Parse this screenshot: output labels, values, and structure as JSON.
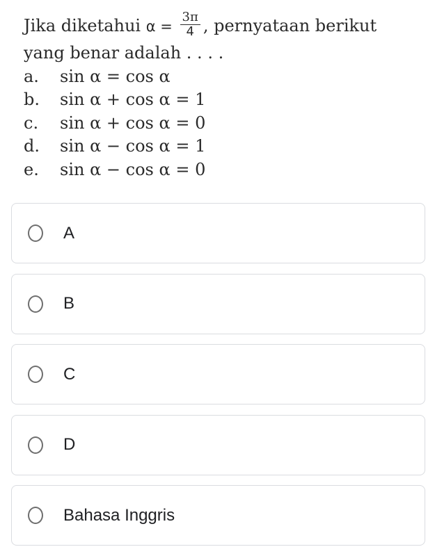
{
  "question": {
    "line1_before": "Jika diketahui ",
    "alpha": "α",
    "equals": " = ",
    "frac_num": "3π",
    "frac_den": "4",
    "line1_after": ", pernyataan berikut",
    "line2": "yang benar adalah . . . ."
  },
  "options": [
    {
      "letter": "a.",
      "expr": "sin α = cos α"
    },
    {
      "letter": "b.",
      "expr": "sin α + cos α = 1"
    },
    {
      "letter": "c.",
      "expr": "sin α + cos α = 0"
    },
    {
      "letter": "d.",
      "expr": "sin α − cos α = 1"
    },
    {
      "letter": "e.",
      "expr": "sin α − cos α = 0"
    }
  ],
  "choices": [
    {
      "label": "A",
      "selected": false
    },
    {
      "label": "B",
      "selected": false
    },
    {
      "label": "C",
      "selected": false
    },
    {
      "label": "D",
      "selected": false
    },
    {
      "label": "Bahasa Inggris",
      "selected": false
    }
  ]
}
